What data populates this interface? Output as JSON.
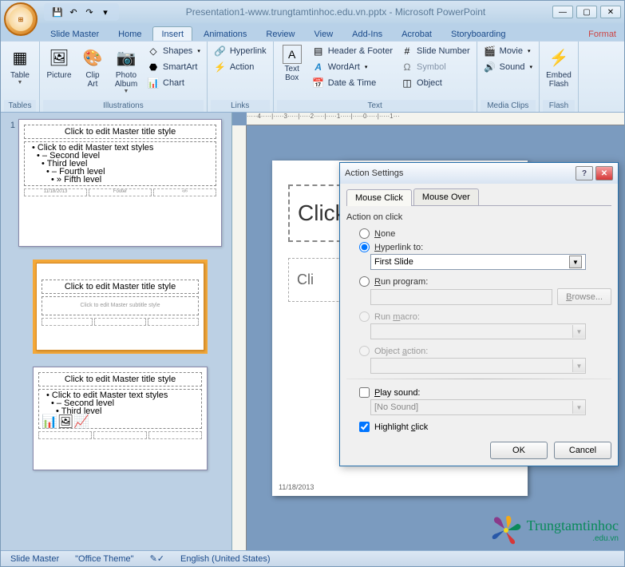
{
  "titlebar": {
    "title": "Presentation1-www.trungtamtinhoc.edu.vn.pptx - Microsoft PowerPoint"
  },
  "tabs": {
    "slide_master": "Slide Master",
    "home": "Home",
    "insert": "Insert",
    "animations": "Animations",
    "review": "Review",
    "view": "View",
    "addins": "Add-Ins",
    "acrobat": "Acrobat",
    "storyboarding": "Storyboarding",
    "format": "Format"
  },
  "ribbon": {
    "tables": {
      "label": "Tables",
      "table": "Table"
    },
    "illustrations": {
      "label": "Illustrations",
      "picture": "Picture",
      "clip_art": "Clip\nArt",
      "photo_album": "Photo\nAlbum",
      "shapes": "Shapes",
      "smartart": "SmartArt",
      "chart": "Chart"
    },
    "links": {
      "label": "Links",
      "hyperlink": "Hyperlink",
      "action": "Action"
    },
    "text": {
      "label": "Text",
      "text_box": "Text\nBox",
      "header_footer": "Header & Footer",
      "wordart": "WordArt",
      "date_time": "Date & Time",
      "slide_number": "Slide Number",
      "symbol": "Symbol",
      "object": "Object"
    },
    "media": {
      "label": "Media Clips",
      "movie": "Movie",
      "sound": "Sound"
    },
    "flash": {
      "label": "Flash",
      "embed": "Embed\nFlash"
    }
  },
  "ruler_marks": "·····4·····|·····3·····|·····2·····|·····1·····|·····0·····|·····1···",
  "thumbs": {
    "num": "1",
    "master_title": "Click to edit Master title style",
    "master_text": "Click to edit Master text styles",
    "second": "Second level",
    "third": "Third level",
    "fourth": "Fourth level",
    "fifth": "Fifth level",
    "subtitle": "Click to edit Master subtitle style",
    "footer_date": "11/18/2013",
    "footer_mid": "Footer",
    "footer_num": "‹#›"
  },
  "slide": {
    "title": "Click",
    "sub": "Cli",
    "date": "11/18/2013"
  },
  "dialog": {
    "title": "Action Settings",
    "tab_click": "Mouse Click",
    "tab_over": "Mouse Over",
    "section": "Action on click",
    "none": "None",
    "hyperlink_to": "Hyperlink to:",
    "hyperlink_value": "First Slide",
    "run_program": "Run program:",
    "browse": "Browse...",
    "run_macro": "Run macro:",
    "object_action": "Object action:",
    "play_sound": "Play sound:",
    "sound_value": "[No Sound]",
    "highlight": "Highlight click",
    "ok": "OK",
    "cancel": "Cancel"
  },
  "statusbar": {
    "slide_master": "Slide Master",
    "theme": "\"Office Theme\"",
    "lang": "English (United States)"
  },
  "logo": {
    "main": "Trungtamtinhoc",
    "sub": ".edu.vn"
  }
}
